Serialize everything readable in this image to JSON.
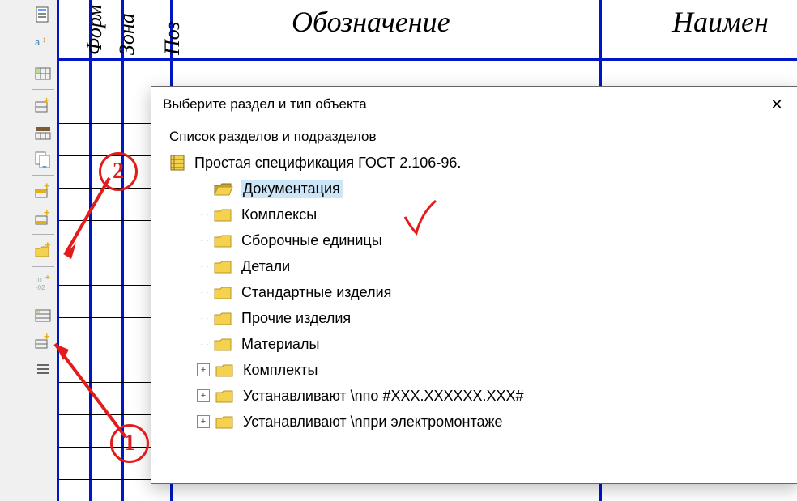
{
  "headers": {
    "col1": "Форм",
    "col2": "Зона",
    "col3": "Поз",
    "designation": "Обозначение",
    "name": "Наимен"
  },
  "toolbar_icons": [
    "page-icon",
    "wizard-a-icon",
    "",
    "grid-icon",
    "",
    "grid-plus-icon",
    "table-icon",
    "page-swap-icon",
    "",
    "block-add-icon",
    "block-add2-icon",
    "",
    "folder-add-icon",
    "",
    "num-icon",
    "",
    "table2-icon",
    "table-row-add-icon",
    "list-icon"
  ],
  "dialog": {
    "title": "Выберите раздел и тип объекта",
    "close": "✕",
    "list_label": "Список разделов и подразделов",
    "root": "Простая спецификация ГОСТ 2.106-96.",
    "items": [
      {
        "label": "Документация",
        "selected": true,
        "exp": null
      },
      {
        "label": "Комплексы",
        "selected": false,
        "exp": null
      },
      {
        "label": "Сборочные единицы",
        "selected": false,
        "exp": null
      },
      {
        "label": "Детали",
        "selected": false,
        "exp": null
      },
      {
        "label": "Стандартные изделия",
        "selected": false,
        "exp": null
      },
      {
        "label": "Прочие изделия",
        "selected": false,
        "exp": null
      },
      {
        "label": "Материалы",
        "selected": false,
        "exp": null
      },
      {
        "label": "Комплекты",
        "selected": false,
        "exp": "+"
      },
      {
        "label": "Устанавливают \\nпо #XXX.XXXXXX.XXX#",
        "selected": false,
        "exp": "+"
      },
      {
        "label": "Устанавливают \\nпри электромонтаже",
        "selected": false,
        "exp": "+"
      }
    ]
  },
  "annotations": {
    "one": "1",
    "two": "2"
  }
}
